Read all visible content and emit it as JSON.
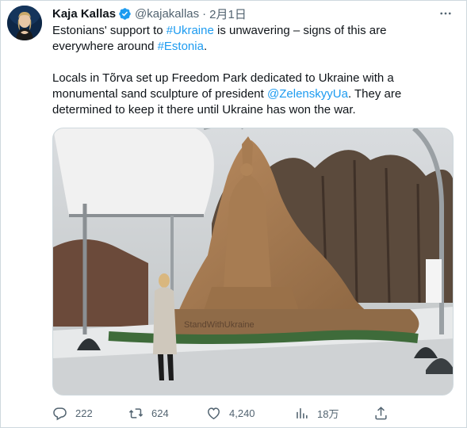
{
  "tweet": {
    "author_name": "Kaja Kallas",
    "handle": "@kajakallas",
    "separator": "·",
    "date": "2月1日",
    "line1_a": "Estonians' support to ",
    "line1_link": "#Ukraine",
    "line1_b": " is unwavering – signs of this are",
    "line2_a": "everywhere around ",
    "line2_link": "#Estonia",
    "line2_b": ".",
    "line3": "Locals in Tõrva set up Freedom Park dedicated to Ukraine with a",
    "line4_a": "monumental sand sculpture of president ",
    "line4_link": "@ZelenskyyUa",
    "line4_b": ". They are",
    "line5": "determined to keep it there until Ukraine has won the war.",
    "image_caption_text": "StandWithUkraine"
  },
  "actions": {
    "reply_count": "222",
    "retweet_count": "624",
    "like_count": "4,240",
    "views_count": "18万"
  },
  "colors": {
    "link": "#1d9bf0",
    "verified": "#1d9bf0",
    "muted": "#536471"
  },
  "icons": {
    "verified": "verified-badge-icon",
    "more": "more-dots-icon",
    "reply": "reply-icon",
    "retweet": "retweet-icon",
    "like": "heart-icon",
    "views": "views-bar-chart-icon",
    "share": "share-icon"
  }
}
